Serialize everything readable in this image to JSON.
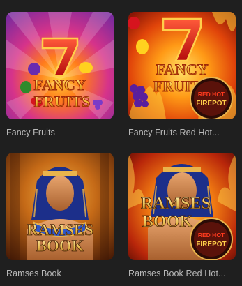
{
  "games": [
    {
      "title": "Fancy Fruits",
      "art_word_1": "FANCY",
      "art_word_2": "FRUITS",
      "art_badge_1": "",
      "art_badge_2": "",
      "icon": "fancy-fruits-thumbnail"
    },
    {
      "title": "Fancy Fruits Red Hot...",
      "art_word_1": "FANCY",
      "art_word_2": "FRUITS",
      "art_badge_1": "RED HOT",
      "art_badge_2": "FIREPOT",
      "icon": "fancy-fruits-red-hot-firepot-thumbnail"
    },
    {
      "title": "Ramses Book",
      "art_word_1": "RAMSES",
      "art_word_2": "BOOK",
      "art_badge_1": "",
      "art_badge_2": "",
      "icon": "ramses-book-thumbnail"
    },
    {
      "title": "Ramses Book Red Hot...",
      "art_word_1": "RAMSES",
      "art_word_2": "BOOK",
      "art_badge_1": "RED HOT",
      "art_badge_2": "FIREPOT",
      "icon": "ramses-book-red-hot-firepot-thumbnail"
    }
  ],
  "colors": {
    "background": "#1f1f1f",
    "caption": "#b9b9b9",
    "fancy_purple": "#9a2fa8",
    "fancy_orange": "#ff7a1a",
    "fire_red": "#c81c0c",
    "gold": "#e9b44c"
  }
}
